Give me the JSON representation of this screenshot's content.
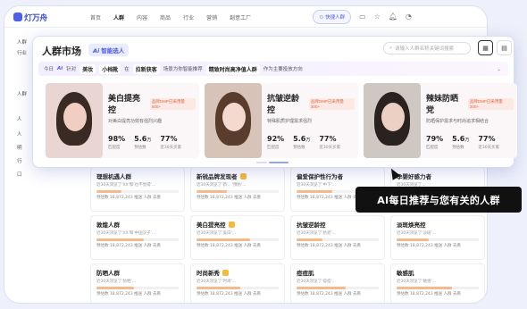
{
  "app": {
    "logo": "灯万舟",
    "nav": [
      "首页",
      "人群",
      "内容",
      "商品",
      "行业",
      "营销",
      "創意工厂"
    ],
    "nav_active_index": 1,
    "cta": "快捷人群",
    "sidebar": [
      "人群",
      "行业",
      "人群",
      "人",
      "人",
      "明",
      "行",
      "口"
    ]
  },
  "overlay": {
    "title": "人群市场",
    "ai_tag_ai": "Ai",
    "ai_tag_label": "智能选人",
    "search_placeholder": "请输入人群名称关键词搜索",
    "rec": {
      "today": "今日",
      "ai": "Ai",
      "for": "针对",
      "t1": "美妆",
      "t2": "小档靴",
      "t3": "在",
      "t4": "拉新获客",
      "t5": "场景为你智能推荐",
      "t6": "精致时尚高净值人群",
      "t7": "作为主要投放方向"
    },
    "tiles": [
      {
        "name": "美白提亮控",
        "tag": "品牌DMP已采用量 500+",
        "desc": "对美白提亮功效有强烈兴趣",
        "stats": [
          {
            "value": "98%",
            "label": "匹配度"
          },
          {
            "value": "5.6",
            "unit": "万",
            "label": "预估数"
          },
          {
            "value": "77%",
            "label": "近30天买家"
          }
        ],
        "colors": {
          "bg": "#e9d6d2",
          "face": "#f0cfc2",
          "hair": "#3a2a24"
        }
      },
      {
        "name": "抗皱逆龄控",
        "tag": "品牌DMP已采用量 300+",
        "desc": "特殊肌质护理需求强烈",
        "stats": [
          {
            "value": "92%",
            "label": "匹配度"
          },
          {
            "value": "5.6",
            "unit": "万",
            "label": "预估数"
          },
          {
            "value": "77%",
            "label": "近30天买家"
          }
        ],
        "colors": {
          "bg": "#d8c3b8",
          "face": "#f4d9cf",
          "hair": "#5a3c2c"
        }
      },
      {
        "name": "辣妹防晒党",
        "tag": "品牌DMP已采用量 200+",
        "desc": "防晒保护需求与时尚追求相结合",
        "stats": [
          {
            "value": "79%",
            "label": "匹配度"
          },
          {
            "value": "5.6",
            "unit": "万",
            "label": "预估数"
          },
          {
            "value": "77%",
            "label": "近30天买家"
          }
        ],
        "colors": {
          "bg": "#cfc7c2",
          "face": "#ecd0c4",
          "hair": "#2a221e"
        }
      }
    ]
  },
  "grid_cards": [
    {
      "name": "理想机遇人群",
      "desc": "近30天浏览了'XX'和'也不觉得'..."
    },
    {
      "name": "新锐品牌发现者",
      "desc": "近30天浏览了'新'、'预防'..."
    },
    {
      "name": "偏爱保护性行为者",
      "desc": "近30天浏览了'中下'..."
    },
    {
      "name": "孕婴好感力者",
      "desc": "近30天浏览了..."
    },
    {
      "name": "敦煌人群",
      "desc": "近30天浏览了'XX'和'中国汉子'..."
    },
    {
      "name": "美白提亮控",
      "desc": "近30天浏览了'美白'..."
    },
    {
      "name": "抗皱逆龄控",
      "desc": "近30天浏览了'抗老'..."
    },
    {
      "name": "淡斑焕亮控",
      "desc": "近30天浏览了'淡斑'..."
    },
    {
      "name": "防晒人群",
      "desc": "近30天浏览了'防晒'..."
    },
    {
      "name": "时尚新秀",
      "desc": "近30天浏览了'时尚'..."
    },
    {
      "name": "痘痘肌",
      "desc": "近30天浏览了'痘痘'..."
    },
    {
      "name": "敏感肌",
      "desc": "近30天浏览了'敏感'..."
    }
  ],
  "grid_card_meta": "预估数 18,872,243  推送  人群  去看",
  "tooltip": "AI每日推荐与您有关的人群",
  "colors": {
    "accent": "#5160e8",
    "tooltip_bg": "#111111"
  }
}
